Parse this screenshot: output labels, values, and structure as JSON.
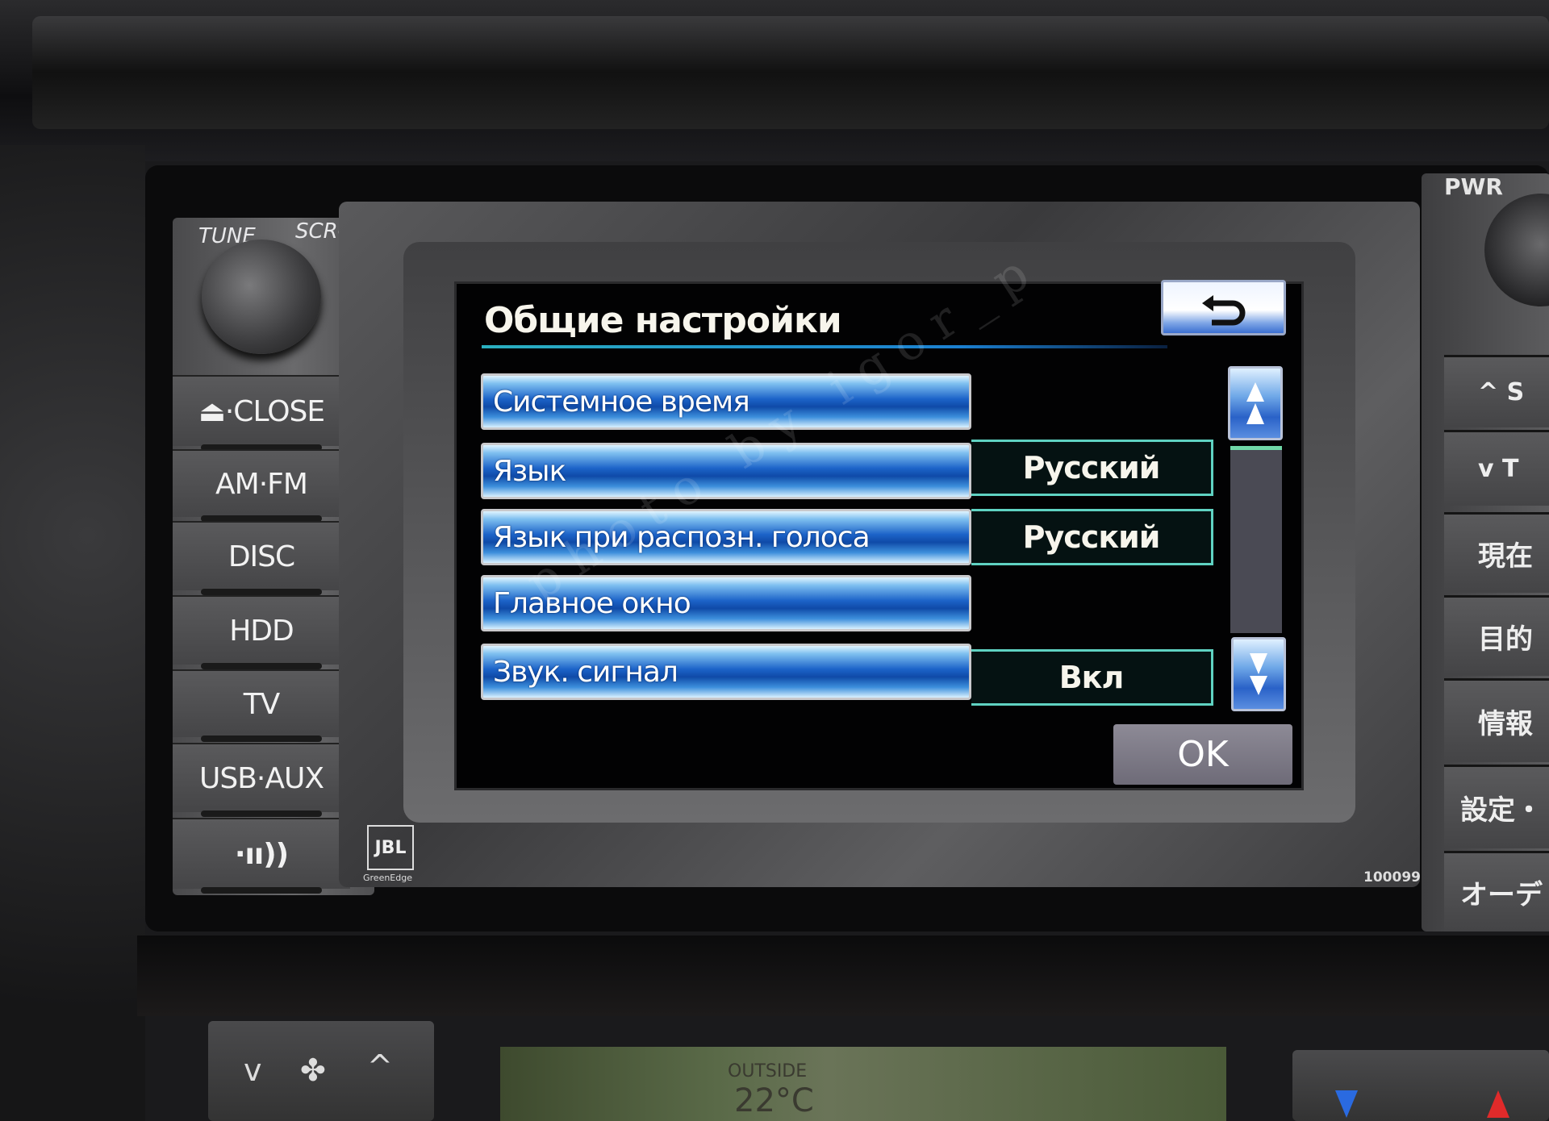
{
  "screen": {
    "title": "Общие настройки",
    "back_icon": "return-arrow-icon",
    "rows": [
      {
        "label": "Системное время",
        "value": null
      },
      {
        "label": "Язык",
        "value": "Русский"
      },
      {
        "label": "Язык при распозн. голоса",
        "value": "Русский"
      },
      {
        "label": "Главное окно",
        "value": null
      },
      {
        "label": "Звук. сигнал",
        "value": "Вкл"
      }
    ],
    "scroll_up_icon": "double-chevron-up-icon",
    "scroll_down_icon": "double-chevron-down-icon",
    "ok_label": "OK",
    "watermark": "photo by igor_p",
    "colors": {
      "row_blue": "#1c63c8",
      "value_border": "#5fd2c2",
      "ok_gray": "#7d7a86",
      "separator": "#2ab0c0"
    }
  },
  "head_unit": {
    "tune_label": "TUNE",
    "scroll_label": "SCROLL",
    "buttons": [
      "⏏·CLOSE",
      "AM·FM",
      "DISC",
      "HDD",
      "TV",
      "USB·AUX",
      "·ıı))"
    ],
    "pwr_label": "PWR",
    "seek_up_label": "^ S",
    "seek_down_label": "v T",
    "right_buttons": [
      "現在",
      "目的",
      "情報",
      "設定・",
      "オーデ"
    ],
    "brand": "JBL",
    "brand_sub": "GreenEdge",
    "serial": "100099"
  },
  "climate": {
    "outside_label": "OUTSIDE",
    "temperature": "22°C",
    "fan_down": "v",
    "fan_up": "^"
  }
}
